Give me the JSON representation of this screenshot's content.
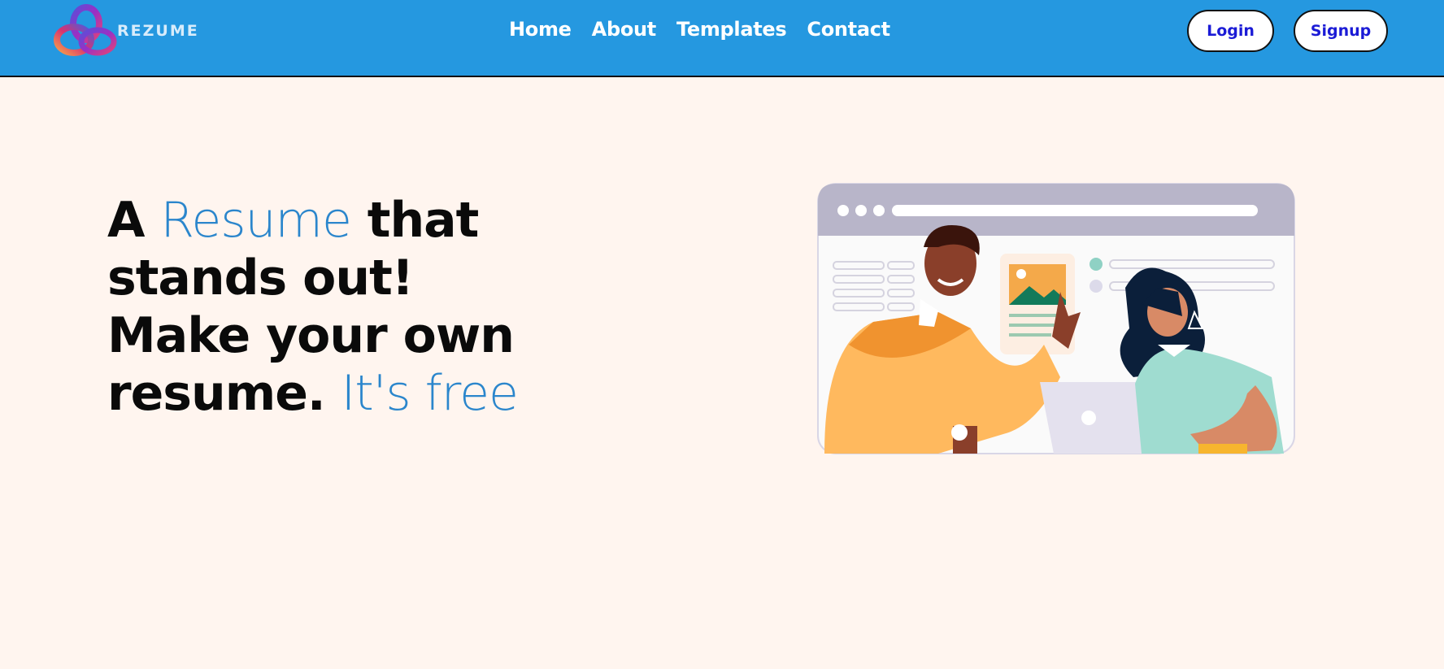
{
  "brand": {
    "name": "REZUME",
    "logo_icon": "interlocked-rings-logo"
  },
  "nav": {
    "links": [
      {
        "label": "Home"
      },
      {
        "label": "About"
      },
      {
        "label": "Templates"
      },
      {
        "label": "Contact"
      }
    ],
    "login_label": "Login",
    "signup_label": "Signup"
  },
  "hero": {
    "word_a": "A",
    "word_resume": "Resume",
    "word_that": "that",
    "line_2": "stands out!",
    "line_3": "Make your own",
    "word_resume_end": "resume.",
    "word_free": "It's free"
  },
  "illustration": {
    "icon": "people-collaborating-illustration"
  },
  "colors": {
    "navbar": "#2598e0",
    "background": "#fff5ef",
    "accent_text": "#2b86cc",
    "button_text": "#1b1bd6"
  }
}
